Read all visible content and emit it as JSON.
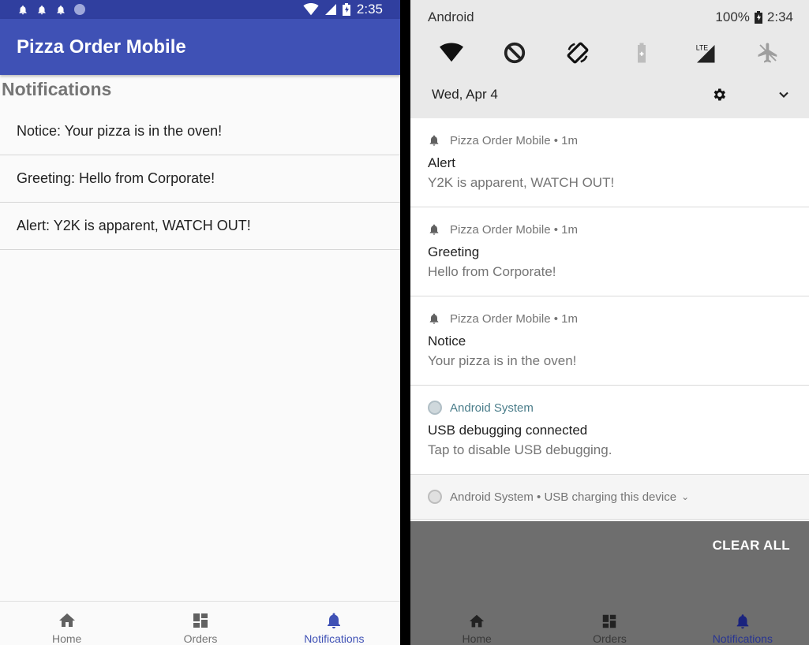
{
  "left": {
    "status_bar": {
      "time": "2:35"
    },
    "app_title": "Pizza Order Mobile",
    "page_title": "Notifications",
    "notifications": [
      "Notice: Your pizza is in the oven!",
      "Greeting: Hello from Corporate!",
      "Alert: Y2K is apparent, WATCH OUT!"
    ],
    "nav": [
      {
        "label": "Home",
        "icon": "home-icon"
      },
      {
        "label": "Orders",
        "icon": "dashboard-icon"
      },
      {
        "label": "Notifications",
        "icon": "bell-icon"
      }
    ],
    "accent": "#3f51b5"
  },
  "right": {
    "status_bar": {
      "carrier": "Android",
      "battery": "100%",
      "time": "2:34"
    },
    "date": "Wed, Apr 4",
    "notifications": [
      {
        "app": "Pizza Order Mobile • 1m",
        "title": "Alert",
        "body": "Y2K is apparent, WATCH OUT!"
      },
      {
        "app": "Pizza Order Mobile • 1m",
        "title": "Greeting",
        "body": "Hello from Corporate!"
      },
      {
        "app": "Pizza Order Mobile • 1m",
        "title": "Notice",
        "body": "Your pizza is in the oven!"
      },
      {
        "app": "Android System",
        "title": "USB debugging connected",
        "body": "Tap to disable USB debugging."
      }
    ],
    "collapsed": "Android System • USB charging this device",
    "clear_all": "CLEAR ALL",
    "nav": [
      {
        "label": "Home"
      },
      {
        "label": "Orders"
      },
      {
        "label": "Notifications"
      }
    ]
  }
}
